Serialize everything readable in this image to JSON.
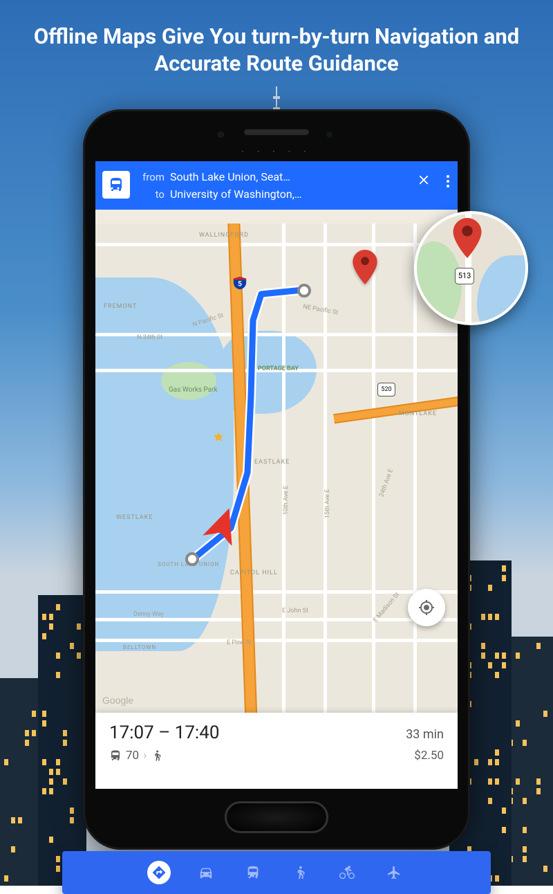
{
  "promo": {
    "headline": "Offline Maps Give You turn-by-turn Navigation and Accurate Route Guidance"
  },
  "directions_header": {
    "from_label": "from",
    "to_label": "to",
    "from_value": "South Lake Union, Seat…",
    "to_value": "University of Washington,…"
  },
  "map": {
    "attribution": "Google",
    "interstate_label": "5",
    "route_520": "520",
    "route_513": "513",
    "neighborhoods": {
      "wallingford": "WALLINGFORD",
      "fremont": "FREMONT",
      "eastlake": "EASTLAKE",
      "westlake": "WESTLAKE",
      "capitol_hill": "CAPITOL HILL",
      "montlake": "MONTLAKE",
      "south_lake_union": "SOUTH LAKE UNION",
      "belltown": "BELLTOWN",
      "portage_bay": "PORTAGE BAY"
    },
    "streets": {
      "n34": "N 34th St",
      "n_pacific": "N Pacific St",
      "ne_pacific": "NE Pacific St",
      "tenth": "10th Ave E",
      "fifteenth": "15th Ave E",
      "twentyfourth": "24th Ave E",
      "denny": "Denny Way",
      "ejohn": "E John St",
      "epine": "E Pine St",
      "emadison": "E Madison St"
    },
    "park_label": "Gas Works Park"
  },
  "zoom_bubble": {
    "route_label": "513"
  },
  "trip_summary": {
    "time_range": "17:07 – 17:40",
    "duration": "33 min",
    "bus_route": "70",
    "fare": "$2.50"
  },
  "mode_bar": {
    "modes": [
      "directions",
      "drive",
      "transit",
      "walk",
      "bike",
      "fly"
    ]
  }
}
